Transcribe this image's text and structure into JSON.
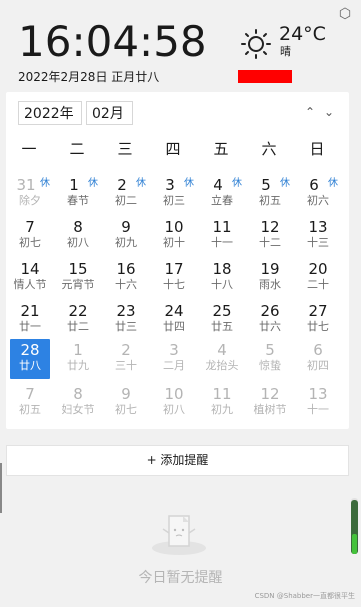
{
  "clock": {
    "time": "16:04:58",
    "date": "2022年2月28日 正月廿八"
  },
  "weather": {
    "temp": "24°C",
    "desc": "晴",
    "icon": "sun-icon"
  },
  "calendar": {
    "year": "2022年",
    "month": "02月",
    "weekdays": [
      "一",
      "二",
      "三",
      "四",
      "五",
      "六",
      "日"
    ],
    "rows": [
      [
        {
          "d": "31",
          "l": "除夕",
          "rest": "休",
          "cur": false
        },
        {
          "d": "1",
          "l": "春节",
          "rest": "休",
          "cur": true
        },
        {
          "d": "2",
          "l": "初二",
          "rest": "休",
          "cur": true
        },
        {
          "d": "3",
          "l": "初三",
          "rest": "休",
          "cur": true
        },
        {
          "d": "4",
          "l": "立春",
          "rest": "休",
          "cur": true
        },
        {
          "d": "5",
          "l": "初五",
          "rest": "休",
          "cur": true
        },
        {
          "d": "6",
          "l": "初六",
          "rest": "休",
          "cur": true
        }
      ],
      [
        {
          "d": "7",
          "l": "初七",
          "cur": true
        },
        {
          "d": "8",
          "l": "初八",
          "cur": true
        },
        {
          "d": "9",
          "l": "初九",
          "cur": true
        },
        {
          "d": "10",
          "l": "初十",
          "cur": true
        },
        {
          "d": "11",
          "l": "十一",
          "cur": true
        },
        {
          "d": "12",
          "l": "十二",
          "cur": true
        },
        {
          "d": "13",
          "l": "十三",
          "cur": true
        }
      ],
      [
        {
          "d": "14",
          "l": "情人节",
          "cur": true
        },
        {
          "d": "15",
          "l": "元宵节",
          "cur": true
        },
        {
          "d": "16",
          "l": "十六",
          "cur": true
        },
        {
          "d": "17",
          "l": "十七",
          "cur": true
        },
        {
          "d": "18",
          "l": "十八",
          "cur": true
        },
        {
          "d": "19",
          "l": "雨水",
          "cur": true
        },
        {
          "d": "20",
          "l": "二十",
          "cur": true
        }
      ],
      [
        {
          "d": "21",
          "l": "廿一",
          "cur": true
        },
        {
          "d": "22",
          "l": "廿二",
          "cur": true
        },
        {
          "d": "23",
          "l": "廿三",
          "cur": true
        },
        {
          "d": "24",
          "l": "廿四",
          "cur": true
        },
        {
          "d": "25",
          "l": "廿五",
          "cur": true
        },
        {
          "d": "26",
          "l": "廿六",
          "cur": true
        },
        {
          "d": "27",
          "l": "廿七",
          "cur": true
        }
      ],
      [
        {
          "d": "28",
          "l": "廿八",
          "cur": true,
          "today": true
        },
        {
          "d": "1",
          "l": "廿九",
          "cur": false
        },
        {
          "d": "2",
          "l": "三十",
          "cur": false
        },
        {
          "d": "3",
          "l": "二月",
          "cur": false
        },
        {
          "d": "4",
          "l": "龙抬头",
          "cur": false
        },
        {
          "d": "5",
          "l": "惊蛰",
          "cur": false
        },
        {
          "d": "6",
          "l": "初四",
          "cur": false
        }
      ],
      [
        {
          "d": "7",
          "l": "初五",
          "cur": false
        },
        {
          "d": "8",
          "l": "妇女节",
          "cur": false
        },
        {
          "d": "9",
          "l": "初七",
          "cur": false
        },
        {
          "d": "10",
          "l": "初八",
          "cur": false
        },
        {
          "d": "11",
          "l": "初九",
          "cur": false
        },
        {
          "d": "12",
          "l": "植树节",
          "cur": false
        },
        {
          "d": "13",
          "l": "十一",
          "cur": false
        }
      ]
    ]
  },
  "reminder": {
    "add_label": "+ 添加提醒",
    "empty_text": "今日暂无提醒"
  },
  "watermark": "CSDN @Shabber一直都很平生",
  "colors": {
    "accent": "#2d82e3",
    "rest": "#2d7fd3",
    "redacted": "#ff0000"
  }
}
